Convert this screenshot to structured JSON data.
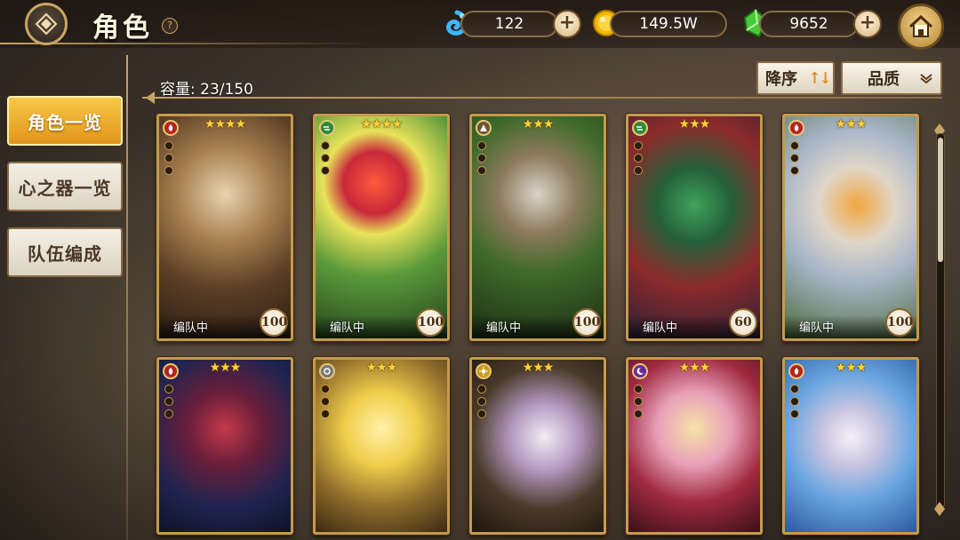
{
  "header": {
    "title": "角色",
    "help": "?",
    "currencies": [
      {
        "name": "spirit-orb",
        "value": "122"
      },
      {
        "name": "gold",
        "value": "149.5W"
      },
      {
        "name": "green-crystal",
        "value": "9652"
      }
    ]
  },
  "sidebar": {
    "items": [
      {
        "label": "角色一览",
        "active": true
      },
      {
        "label": "心之器一览",
        "active": false
      },
      {
        "label": "队伍编成",
        "active": false
      }
    ]
  },
  "main": {
    "capacity": "容量: 23/150",
    "sort_label": "降序",
    "filter_label": "品质"
  },
  "cards": [
    {
      "stars": "★★★★",
      "element": "fire",
      "tag": "编队中",
      "level": "100"
    },
    {
      "stars": "★★★★",
      "element": "wind",
      "tag": "编队中",
      "level": "100"
    },
    {
      "stars": "★★★",
      "element": "earth",
      "tag": "编队中",
      "level": "100"
    },
    {
      "stars": "★★★",
      "element": "wind",
      "tag": "编队中",
      "level": "60"
    },
    {
      "stars": "★★★",
      "element": "fire",
      "tag": "编队中",
      "level": "100"
    },
    {
      "stars": "★★★",
      "element": "fire",
      "tag": "",
      "level": ""
    },
    {
      "stars": "★★★",
      "element": "neutral",
      "tag": "",
      "level": ""
    },
    {
      "stars": "★★★",
      "element": "light",
      "tag": "",
      "level": ""
    },
    {
      "stars": "★★★",
      "element": "dark",
      "tag": "",
      "level": ""
    },
    {
      "stars": "★★★",
      "element": "fire",
      "tag": "",
      "level": ""
    }
  ],
  "colors": {
    "accent_gold": "#c9a565",
    "active_tab": "#f0b030"
  }
}
